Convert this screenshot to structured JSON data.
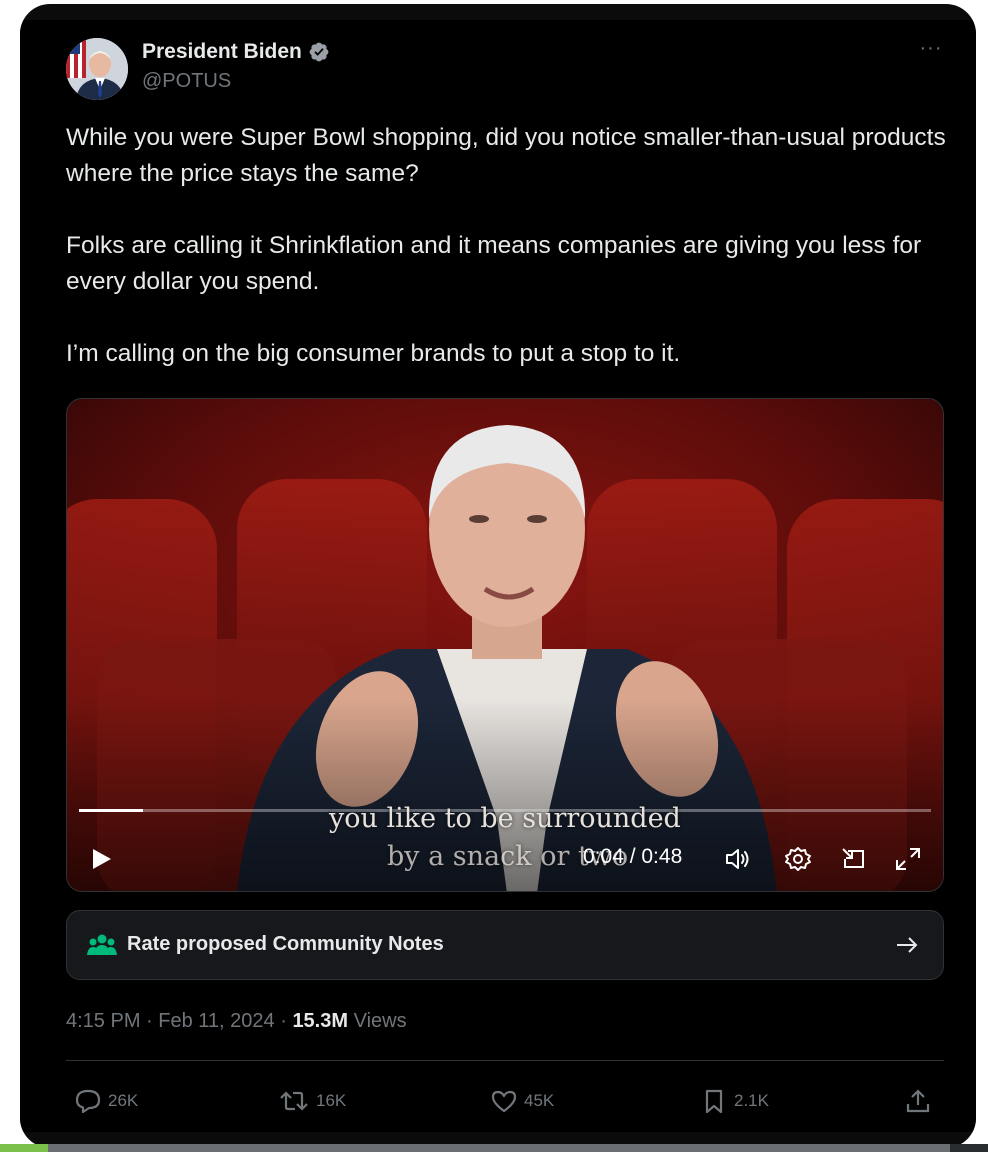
{
  "author": {
    "name": "President Biden",
    "handle": "@POTUS",
    "verified": true
  },
  "tweet": {
    "paragraphs": [
      "While you were Super Bowl shopping, did you notice smaller-than-usual products where the price stays the same?",
      "Folks are calling it Shrinkflation and it means companies are giving you less for every dollar you spend.",
      "I’m calling on the big consumer brands to put a stop to it."
    ]
  },
  "video": {
    "caption_line1": "you like to be surrounded",
    "caption_line2": "by a snack or two",
    "current_time": "0:04",
    "duration": "0:48",
    "time_display": "0:04 / 0:48",
    "progress_fraction": 0.075
  },
  "community_notes": {
    "label": "Rate proposed Community Notes"
  },
  "meta": {
    "time": "4:15 PM",
    "date": "Feb 11, 2024",
    "views_count": "15.3M",
    "views_label": "Views"
  },
  "actions": {
    "replies": "26K",
    "reposts": "16K",
    "likes": "45K",
    "bookmarks": "2.1K"
  },
  "colors": {
    "background": "#000000",
    "text": "#e7e9ea",
    "muted": "#71767b",
    "verified": "#1d9bf0",
    "notes_green": "#00ba7c"
  }
}
